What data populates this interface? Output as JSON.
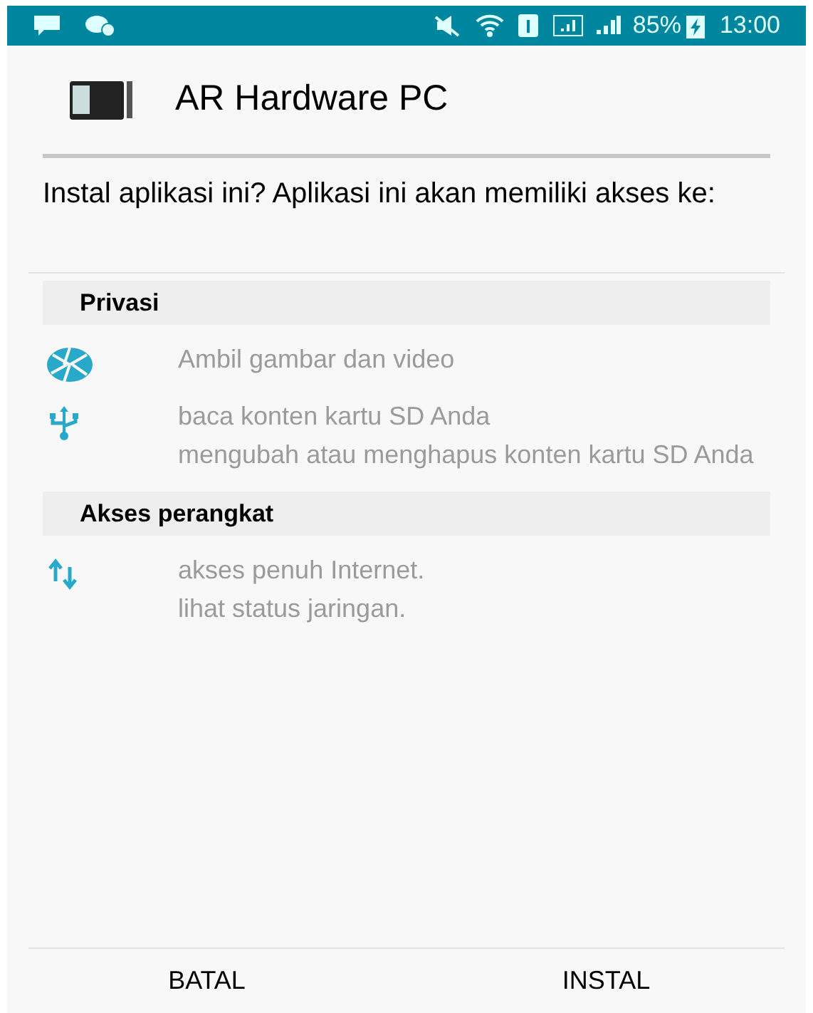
{
  "status_bar": {
    "battery": "85%",
    "time": "13:00"
  },
  "app": {
    "title": "AR Hardware PC"
  },
  "question": "Instal aplikasi ini? Aplikasi ini akan memiliki akses ke:",
  "sections": [
    {
      "title": "Privasi",
      "groups": [
        {
          "kind": "camera",
          "lines": [
            "Ambil gambar dan video"
          ]
        },
        {
          "kind": "usb",
          "lines": [
            "baca konten kartu SD Anda",
            "mengubah atau menghapus konten kartu SD Anda"
          ]
        }
      ]
    },
    {
      "title": "Akses perangkat",
      "groups": [
        {
          "kind": "network",
          "lines": [
            "akses penuh Internet.",
            "lihat status jaringan."
          ]
        }
      ]
    }
  ],
  "buttons": [
    "BATAL",
    "INSTAL"
  ]
}
